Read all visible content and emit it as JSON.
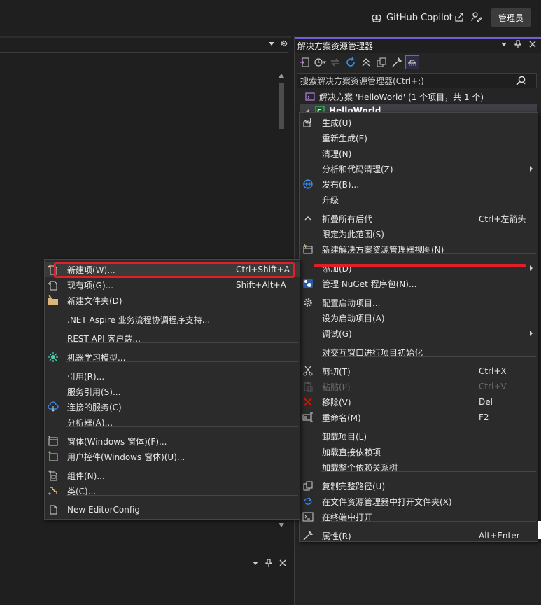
{
  "titlebar": {
    "copilot_label": "GitHub Copilot",
    "admin_label": "管理员"
  },
  "solution_explorer": {
    "title": "解决方案资源管理器",
    "search_placeholder": "搜索解决方案资源管理器(Ctrl+;)",
    "solution_label": "解决方案 'HelloWorld' (1 个项目，共 1 个)",
    "project_label": "HelloWorld"
  },
  "context_menu": {
    "items": [
      {
        "label": "生成(U)",
        "icon": "build-icon",
        "shortcut": ""
      },
      {
        "label": "重新生成(E)",
        "icon": "",
        "shortcut": ""
      },
      {
        "label": "清理(N)",
        "icon": "",
        "shortcut": ""
      },
      {
        "label": "分析和代码清理(Z)",
        "icon": "",
        "shortcut": "",
        "submenu": true
      },
      {
        "label": "发布(B)...",
        "icon": "globe-icon",
        "shortcut": ""
      },
      {
        "label": "升级",
        "icon": "",
        "shortcut": ""
      },
      {
        "label": "折叠所有后代",
        "icon": "chevron-up-icon",
        "shortcut": "Ctrl+左箭头"
      },
      {
        "label": "限定为此范围(S)",
        "icon": "",
        "shortcut": ""
      },
      {
        "label": "新建解决方案资源管理器视图(N)",
        "icon": "new-view-icon",
        "shortcut": ""
      },
      {
        "label": "添加(D)",
        "icon": "",
        "shortcut": "",
        "submenu": true
      },
      {
        "label": "管理 NuGet 程序包(N)...",
        "icon": "nuget-icon",
        "shortcut": ""
      },
      {
        "label": "配置启动项目...",
        "icon": "gear-icon",
        "shortcut": ""
      },
      {
        "label": "设为启动项目(A)",
        "icon": "",
        "shortcut": ""
      },
      {
        "label": "调试(G)",
        "icon": "",
        "shortcut": "",
        "submenu": true
      },
      {
        "label": "对交互窗口进行项目初始化",
        "icon": "",
        "shortcut": ""
      },
      {
        "label": "剪切(T)",
        "icon": "scissors-icon",
        "shortcut": "Ctrl+X"
      },
      {
        "label": "粘贴(P)",
        "icon": "paste-icon",
        "shortcut": "Ctrl+V",
        "disabled": true
      },
      {
        "label": "移除(V)",
        "icon": "close-icon",
        "shortcut": "Del"
      },
      {
        "label": "重命名(M)",
        "icon": "rename-icon",
        "shortcut": "F2"
      },
      {
        "label": "卸载项目(L)",
        "icon": "",
        "shortcut": ""
      },
      {
        "label": "加载直接依赖项",
        "icon": "",
        "shortcut": ""
      },
      {
        "label": "加载整个依赖关系树",
        "icon": "",
        "shortcut": ""
      },
      {
        "label": "复制完整路径(U)",
        "icon": "copy-icon",
        "shortcut": ""
      },
      {
        "label": "在文件资源管理器中打开文件夹(X)",
        "icon": "folder-open-icon",
        "shortcut": ""
      },
      {
        "label": "在终端中打开",
        "icon": "terminal-icon",
        "shortcut": ""
      },
      {
        "label": "属性(R)",
        "icon": "wrench-icon",
        "shortcut": "Alt+Enter"
      }
    ]
  },
  "add_submenu": {
    "items": [
      {
        "label": "新建项(W)...",
        "icon": "new-item-icon",
        "shortcut": "Ctrl+Shift+A"
      },
      {
        "label": "现有项(G)...",
        "icon": "existing-item-icon",
        "shortcut": "Shift+Alt+A"
      },
      {
        "label": "新建文件夹(D)",
        "icon": "folder-icon",
        "shortcut": ""
      },
      {
        "label": ".NET Aspire 业务流程协调程序支持...",
        "icon": "",
        "shortcut": ""
      },
      {
        "label": "REST API 客户端...",
        "icon": "",
        "shortcut": ""
      },
      {
        "label": "机器学习模型...",
        "icon": "ml-icon",
        "shortcut": ""
      },
      {
        "label": "引用(R)...",
        "icon": "",
        "shortcut": ""
      },
      {
        "label": "服务引用(S)...",
        "icon": "",
        "shortcut": ""
      },
      {
        "label": "连接的服务(C)",
        "icon": "connected-service-icon",
        "shortcut": ""
      },
      {
        "label": "分析器(A)...",
        "icon": "",
        "shortcut": ""
      },
      {
        "label": "窗体(Windows 窗体)(F)...",
        "icon": "form-icon",
        "shortcut": ""
      },
      {
        "label": "用户控件(Windows 窗体)(U)...",
        "icon": "user-control-icon",
        "shortcut": ""
      },
      {
        "label": "组件(N)...",
        "icon": "component-icon",
        "shortcut": ""
      },
      {
        "label": "类(C)...",
        "icon": "class-icon",
        "shortcut": ""
      },
      {
        "label": "New EditorConfig",
        "icon": "file-icon",
        "shortcut": ""
      }
    ]
  },
  "colors": {
    "accent": "#6e5fd4",
    "highlight_red": "#e21f26",
    "menu_bg": "#2b2b2b",
    "panel_bg": "#1f1f1f"
  }
}
